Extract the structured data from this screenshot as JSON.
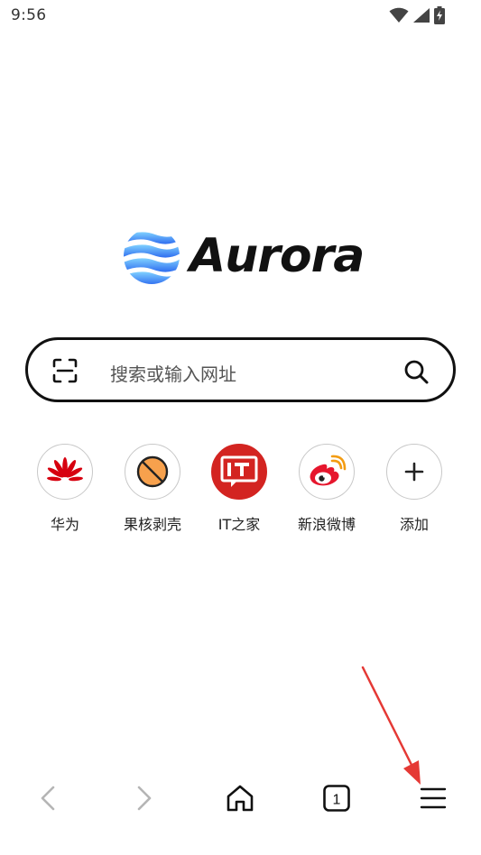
{
  "status_bar": {
    "time": "9:56",
    "icons": [
      "wifi-icon",
      "signal-icon",
      "battery-charging-icon"
    ]
  },
  "logo": {
    "text": "Aurora",
    "icon": "aurora-logo-icon",
    "colors": {
      "light": "#7fd0ff",
      "dark": "#2f6df0"
    }
  },
  "search": {
    "placeholder": "搜索或输入网址",
    "left_icon": "scan-icon",
    "right_icon": "search-icon"
  },
  "shortcuts": [
    {
      "label": "华为",
      "icon": "huawei-icon",
      "color": "#d7000f"
    },
    {
      "label": "果核剥壳",
      "icon": "orange-icon",
      "color": "#f7a14d"
    },
    {
      "label": "IT之家",
      "icon": "ithome-icon",
      "color": "#d32421"
    },
    {
      "label": "新浪微博",
      "icon": "weibo-icon",
      "color": "#e6162d"
    },
    {
      "label": "添加",
      "icon": "plus-icon",
      "color": "#222222"
    }
  ],
  "bottom_nav": {
    "tab_count": "1",
    "items": [
      "back-icon",
      "forward-icon",
      "home-icon",
      "tabs-icon",
      "menu-icon"
    ]
  },
  "annotation": {
    "color": "#e53935"
  }
}
